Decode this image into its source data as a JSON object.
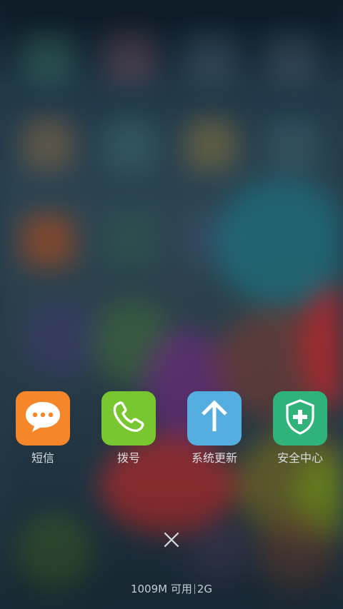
{
  "apps": [
    {
      "label": "短信",
      "icon": "message-bubble-icon",
      "color": "#f5862a"
    },
    {
      "label": "拨号",
      "icon": "phone-handset-icon",
      "color": "#78c630"
    },
    {
      "label": "系统更新",
      "icon": "arrow-up-icon",
      "color": "#55aee0"
    },
    {
      "label": "安全中心",
      "icon": "shield-plus-icon",
      "color": "#2fb37a"
    }
  ],
  "close": {
    "icon": "close-icon"
  },
  "memory": {
    "available": "1009M 可用",
    "total": "2G"
  }
}
